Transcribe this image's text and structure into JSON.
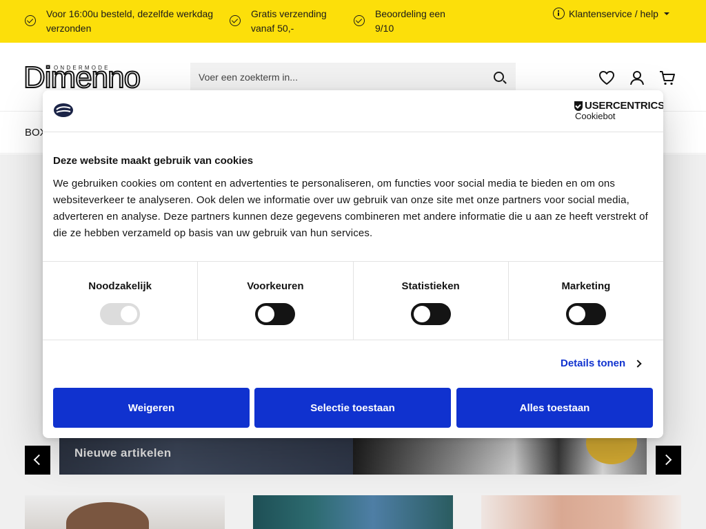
{
  "topbar": {
    "usps": [
      "Voor 16:00u besteld, dezelfde werkdag verzonden",
      "Gratis verzending vanaf 50,-",
      "Beoordeling een 9/10"
    ],
    "service_label": "Klantenservice / help"
  },
  "header": {
    "logo_tagline": "ONDERMODE",
    "logo_text": "Dimenno",
    "search_placeholder": "Voer een zoekterm in...",
    "icons": [
      "heart-icon",
      "user-icon",
      "cart-icon"
    ]
  },
  "nav": {
    "first_item": "BOX"
  },
  "banner": {
    "label": "Nieuwe artikelen"
  },
  "cookie_dialog": {
    "provider_name": "USERCENTRICS",
    "provider_sub": "Cookiebot",
    "title": "Deze website maakt gebruik van cookies",
    "body": "We gebruiken cookies om content en advertenties te personaliseren, om functies voor social media te bieden en om ons websiteverkeer te analyseren. Ook delen we informatie over uw gebruik van onze site met onze partners voor social media, adverteren en analyse. Deze partners kunnen deze gegevens combineren met andere informatie die u aan ze heeft verstrekt of die ze hebben verzameld op basis van uw gebruik van hun services.",
    "categories": [
      {
        "label": "Noodzakelijk",
        "enabled": true
      },
      {
        "label": "Voorkeuren",
        "enabled": false
      },
      {
        "label": "Statistieken",
        "enabled": false
      },
      {
        "label": "Marketing",
        "enabled": false
      }
    ],
    "details_label": "Details tonen",
    "buttons": {
      "deny": "Weigeren",
      "selection": "Selectie toestaan",
      "allow_all": "Alles toestaan"
    }
  },
  "colors": {
    "topbar_bg": "#fcdf0a",
    "accent_blue": "#1032cf",
    "toggle_off": "#141414",
    "toggle_disabled": "#dcdcdc"
  }
}
